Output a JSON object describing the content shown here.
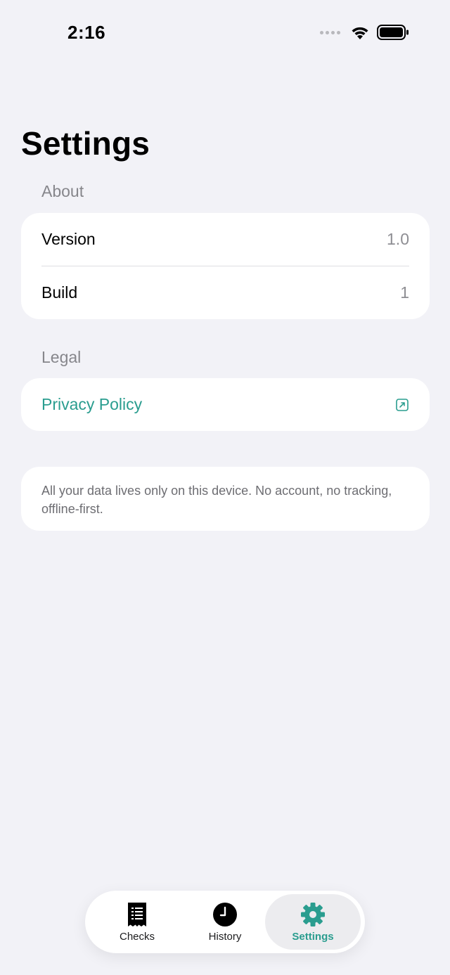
{
  "status_bar": {
    "time": "2:16"
  },
  "page": {
    "title": "Settings"
  },
  "sections": {
    "about": {
      "header": "About",
      "version_label": "Version",
      "version_value": "1.0",
      "build_label": "Build",
      "build_value": "1"
    },
    "legal": {
      "header": "Legal",
      "privacy_label": "Privacy Policy"
    },
    "note": "All your data lives only on this device. No account, no tracking, offline-first."
  },
  "tab_bar": {
    "tabs": [
      {
        "label": "Checks",
        "icon": "receipt-icon",
        "active": false
      },
      {
        "label": "History",
        "icon": "clock-icon",
        "active": false
      },
      {
        "label": "Settings",
        "icon": "gear-icon",
        "active": true
      }
    ]
  },
  "colors": {
    "accent": "#2a9d8f",
    "background": "#f2f2f7",
    "secondary_text": "#8e8e93"
  }
}
